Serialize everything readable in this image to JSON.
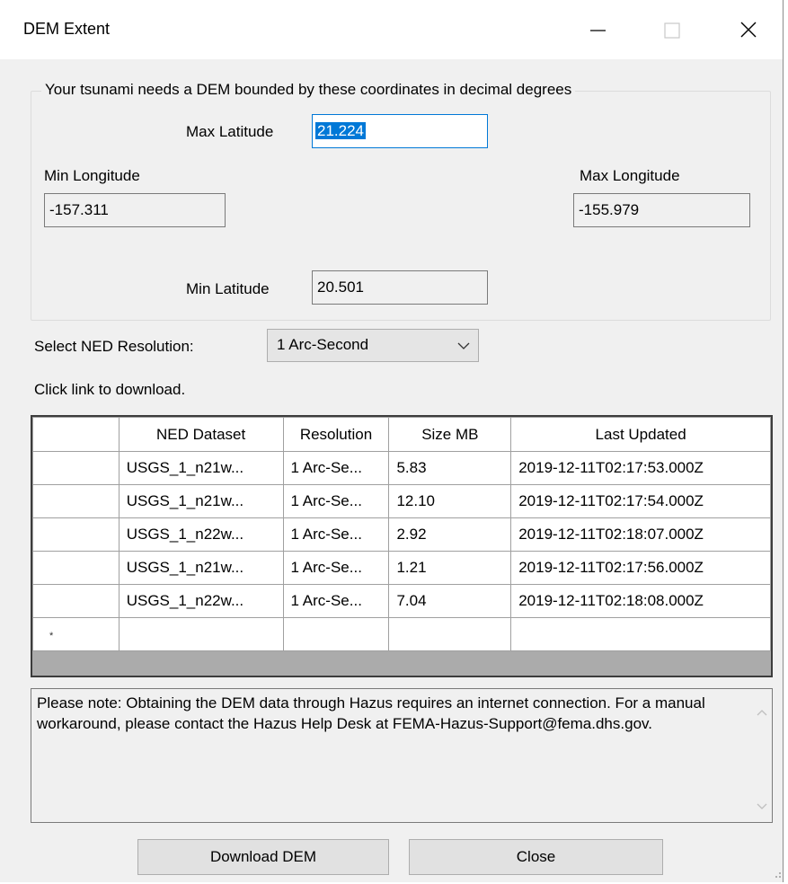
{
  "window": {
    "title": "DEM Extent",
    "controls": {
      "minimize": "minimize-icon",
      "maximize": "maximize-icon",
      "close": "close-icon"
    }
  },
  "extent": {
    "legend": "Your tsunami needs a DEM bounded by these coordinates in decimal degrees",
    "max_latitude": {
      "label": "Max Latitude",
      "value": "21.224"
    },
    "min_longitude": {
      "label": "Min Longitude",
      "value": "-157.311"
    },
    "max_longitude": {
      "label": "Max Longitude",
      "value": "-155.979"
    },
    "min_latitude": {
      "label": "Min Latitude",
      "value": "20.501"
    }
  },
  "resolution": {
    "label": "Select NED Resolution:",
    "selected": "1 Arc-Second"
  },
  "download_hint": "Click link to download.",
  "grid": {
    "headers": [
      "NED Dataset",
      "Resolution",
      "Size MB",
      "Last Updated"
    ],
    "rows": [
      [
        "USGS_1_n21w...",
        "1 Arc-Se...",
        "5.83",
        "2019-12-11T02:17:53.000Z"
      ],
      [
        "USGS_1_n21w...",
        "1 Arc-Se...",
        "12.10",
        "2019-12-11T02:17:54.000Z"
      ],
      [
        "USGS_1_n22w...",
        "1 Arc-Se...",
        "2.92",
        "2019-12-11T02:18:07.000Z"
      ],
      [
        "USGS_1_n21w...",
        "1 Arc-Se...",
        "1.21",
        "2019-12-11T02:17:56.000Z"
      ],
      [
        "USGS_1_n22w...",
        "1 Arc-Se...",
        "7.04",
        "2019-12-11T02:18:08.000Z"
      ]
    ],
    "new_row_marker": "*"
  },
  "note": "Please note: Obtaining the DEM data through Hazus requires an internet connection. For a manual workaround, please contact the Hazus Help Desk at FEMA-Hazus-Support@fema.dhs.gov.",
  "buttons": {
    "download": "Download DEM",
    "close": "Close"
  },
  "colors": {
    "accent": "#0078d7",
    "window_bg": "#f0f0f0",
    "grid_empty": "#ababab"
  }
}
